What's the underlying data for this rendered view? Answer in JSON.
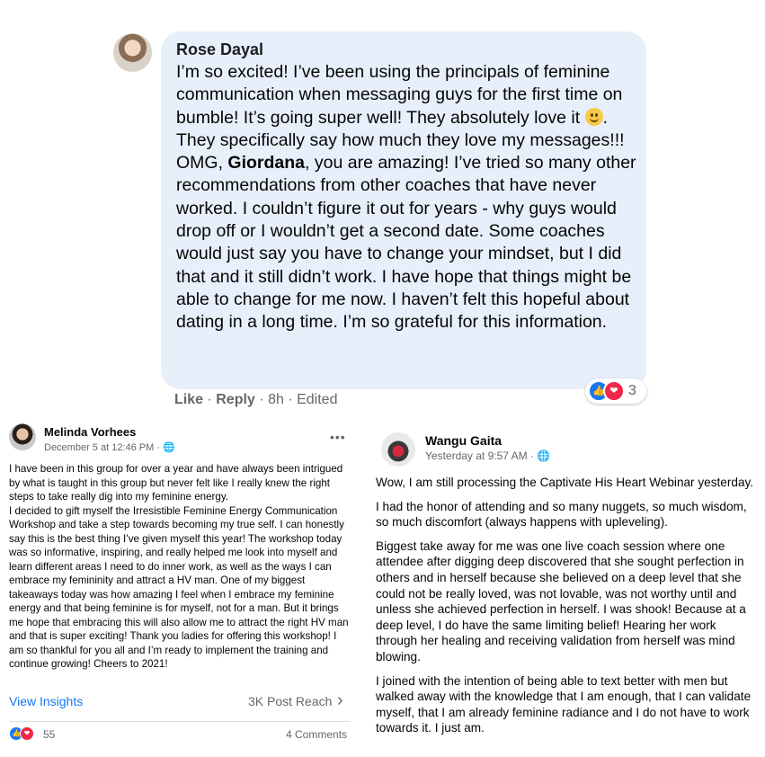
{
  "top_comment": {
    "author": "Rose Dayal",
    "text_before_emoji": "I’m so excited! I’ve been using the principals of feminine communication when messaging guys for the first time on bumble! It’s going super well! They absolutely love it",
    "emoji": "smiling-face",
    "text_after_emoji": ". They specifically say how much they love my messages!!! OMG,",
    "mention": "Giordana",
    "text_after_mention": ", you are amazing! I’ve tried so many other recommendations from other coaches that have never worked. I couldn’t figure it out for years - why guys would drop off or I wouldn’t get a second date. Some coaches would just say you have to change your mindset, but I did that and it still didn’t work. I have hope that things might be able to change for me now. I haven’t felt this hopeful about dating in a long time. I’m so grateful for this information.",
    "like_label": "Like",
    "reply_label": "Reply",
    "separator": "·",
    "time": "8h",
    "edited": "Edited",
    "reaction_count": "3"
  },
  "left_post": {
    "author": "Melinda Vorhees",
    "date": "December 5 at 12:46 PM",
    "audience_icon": "globe-icon",
    "more_label": "•••",
    "body": "I have been in this group for over a year and have always been intrigued by what is taught in this group but never felt like I really knew the right steps to take really dig into my feminine energy.\nI decided to gift myself the Irresistible Feminine Energy Communication Workshop and take a step towards becoming my true self. I can honestly say this is the best thing I’ve given myself this year! The workshop today was so informative, inspiring, and really helped me look into myself and learn different areas I need to do inner work, as well as the ways I can embrace my femininity and attract a HV man. One of my biggest takeaways today was how amazing I feel when I embrace my feminine energy and that being feminine is for myself, not for a man. But it brings me hope that embracing this will also allow me to attract the right HV man and that is super exciting! Thank you ladies for offering this workshop! I am so thankful for you all and I’m ready to implement the training and continue growing! Cheers to 2021!",
    "insights_label": "View Insights",
    "reach_label": "3K Post Reach",
    "reaction_count": "55",
    "comments_label": "4 Comments"
  },
  "right_post": {
    "author": "Wangu Gaita",
    "date": "Yesterday at 9:57 AM",
    "audience_icon": "globe-icon",
    "paragraphs": [
      "Wow, I am still processing the Captivate His Heart Webinar yesterday.",
      "I had the honor of attending and so many nuggets, so much wisdom, so much discomfort (always happens with upleveling).",
      "Biggest take away for me was one live coach session where one attendee after digging deep discovered that she sought perfection in others and in herself because she believed on a deep level that she could not be really loved, was not lovable, was not worthy until and unless she achieved perfection in herself. I was shook! Because at a deep level, I do have the same limiting belief! Hearing her work through her healing and receiving validation from herself was mind blowing.",
      "I joined with the intention of being able to text better with men but walked away with the knowledge that I am enough, that I can validate myself, that I am already feminine radiance and I do not have to work towards it. I just am."
    ]
  },
  "colors": {
    "bubble": "#e7effa",
    "link": "#1877f2",
    "muted": "#65676b",
    "like": "#1877f2",
    "love": "#f0284a"
  }
}
